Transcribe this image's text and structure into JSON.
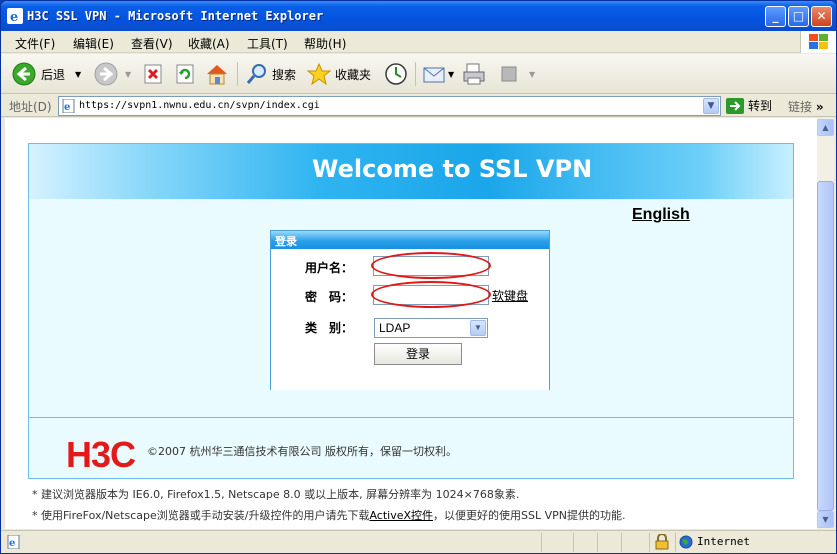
{
  "window": {
    "title": "H3C SSL VPN - Microsoft Internet Explorer",
    "controls": [
      "_",
      "□",
      "✕"
    ]
  },
  "menu": [
    "文件(F)",
    "编辑(E)",
    "查看(V)",
    "收藏(A)",
    "工具(T)",
    "帮助(H)"
  ],
  "toolbar": {
    "back_label": "后退",
    "search_label": "搜索",
    "favorites_label": "收藏夹"
  },
  "address": {
    "label": "地址(D)",
    "url": "https://svpn1.nwnu.edu.cn/svpn/index.cgi",
    "go_label": "转到",
    "links_label": "链接"
  },
  "page": {
    "banner_title": "Welcome to SSL VPN",
    "language_link": "English",
    "login": {
      "header": "登录",
      "username_label": "用户名：",
      "username_value": "",
      "password_label": "密　码：",
      "password_value": "",
      "virtual_keyboard": "软键盘",
      "type_label": "类　别：",
      "type_selected": "LDAP",
      "submit_label": "登录"
    },
    "logo_text": "H3C",
    "copyright": "©2007 杭州华三通信技术有限公司 版权所有，保留一切权利。",
    "note1": "* 建议浏览器版本为 IE6.0, Firefox1.5, Netscape 8.0 或以上版本, 屏幕分辨率为 1024×768象素.",
    "note2_prefix": "* 使用FireFox/Netscape浏览器或手动安装/升级控件的用户请先下载",
    "note2_link": "ActiveX控件",
    "note2_suffix": "，以便更好的使用SSL VPN提供的功能."
  },
  "status": {
    "zone": "Internet"
  },
  "colors": {
    "titlebar": "#0454e0",
    "banner": "#1aa6ea",
    "logo": "#e21a1a",
    "highlight_ellipse": "#e01818"
  }
}
